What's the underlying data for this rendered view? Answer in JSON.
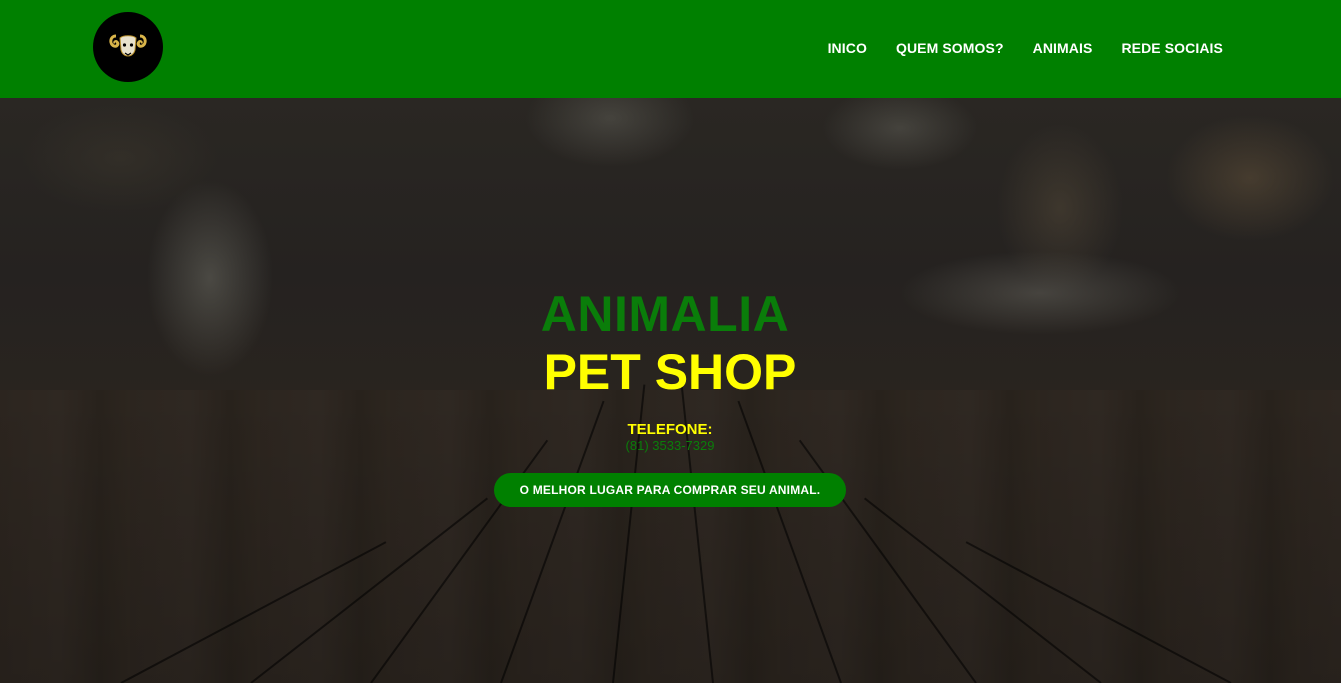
{
  "header": {
    "logo_icon": "ram-head-icon",
    "nav": [
      {
        "label": "INICO"
      },
      {
        "label": "QUEM SOMOS?"
      },
      {
        "label": "ANIMAIS"
      },
      {
        "label": "REDE SOCIAIS"
      }
    ],
    "colors": {
      "background": "#008000",
      "nav_text": "#ffffff"
    }
  },
  "hero": {
    "title_line1": "ANIMALIA",
    "title_line2": "PET SHOP",
    "phone_label": "TELEFONE:",
    "phone_number": "(81) 3533-7329",
    "cta_label": "O MELHOR LUGAR PARA COMPRAR SEU ANIMAL.",
    "colors": {
      "title_green": "#0a7d0a",
      "title_yellow": "#ffff00",
      "cta_bg": "#008000"
    }
  }
}
